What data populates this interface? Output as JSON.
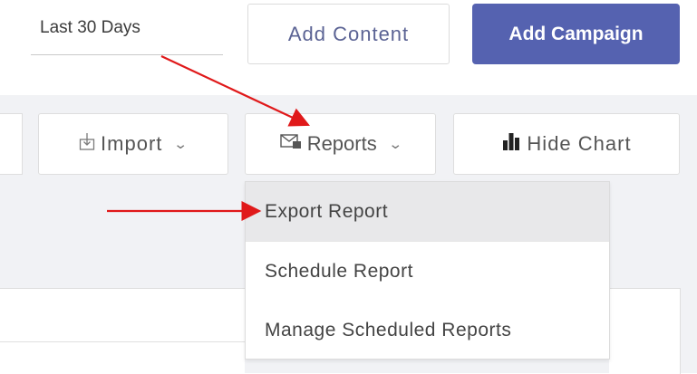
{
  "header": {
    "date_range": "Last 30 Days",
    "add_content_label": "Add Content",
    "add_campaign_label": "Add Campaign"
  },
  "toolbar": {
    "import_label": "Import",
    "reports_label": "Reports",
    "hide_chart_label": "Hide Chart",
    "import_icon": "import-icon",
    "reports_icon": "envelope-icon",
    "hide_chart_icon": "bar-chart-icon"
  },
  "reports_menu": {
    "items": [
      {
        "label": "Export Report",
        "highlighted": true
      },
      {
        "label": "Schedule Report",
        "highlighted": false
      },
      {
        "label": "Manage Scheduled Reports",
        "highlighted": false
      }
    ]
  },
  "colors": {
    "primary_button": "#5562b0",
    "annotation_arrow": "#e0191a",
    "panel_background": "#f1f2f5"
  }
}
